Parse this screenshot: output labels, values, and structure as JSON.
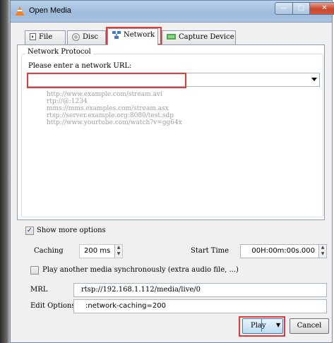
{
  "window": {
    "title": "Open Media"
  },
  "tabs": [
    {
      "label": "File",
      "icon": "file-icon"
    },
    {
      "label": "Disc",
      "icon": "disc-icon"
    },
    {
      "label": "Network",
      "icon": "network-icon"
    },
    {
      "label": "Capture Device",
      "icon": "capture-device-icon"
    }
  ],
  "network": {
    "group_title": "Network Protocol",
    "prompt": "Please enter a network URL:",
    "url_value": "",
    "examples": [
      "http://www.example.com/stream.avi",
      "rtp://@:1234",
      "mms://mms.examples.com/stream.asx",
      "rtsp://server.example.org:8080/test.sdp",
      "http://www.yourtube.com/watch?v=gg64x"
    ]
  },
  "options": {
    "show_more_label": "Show more options",
    "show_more_checked": true,
    "caching_label": "Caching",
    "caching_value": "200 ms",
    "start_time_label": "Start Time",
    "start_time_value": "00H:00m:00s.000",
    "sync_label": "Play another media synchronously (extra audio file, ...)",
    "sync_checked": false,
    "mrl_label": "MRL",
    "mrl_value": "rtsp://192.168.1.112/media/live/0",
    "edit_label": "Edit Options",
    "edit_value": " :network-caching=200"
  },
  "buttons": {
    "play": "Play",
    "cancel": "Cancel"
  },
  "colors": {
    "highlight": "#e53935",
    "accent": "#3c7fb1"
  }
}
